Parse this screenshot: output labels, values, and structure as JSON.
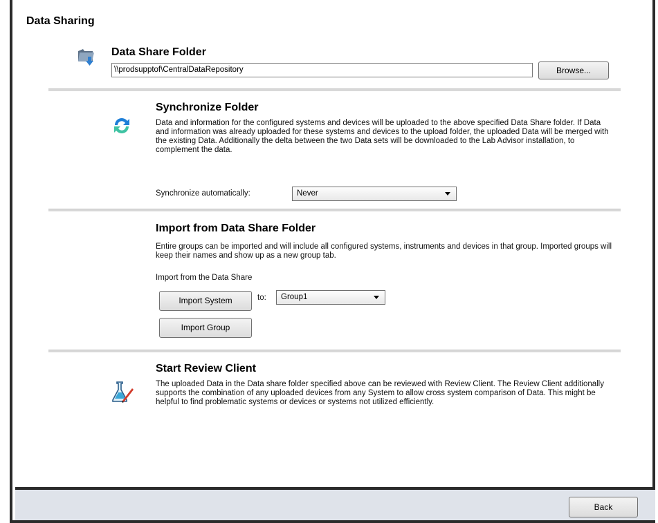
{
  "page_title": "Data Sharing",
  "data_share": {
    "heading": "Data Share Folder",
    "path_value": "\\\\prodsupptof\\CentralDataRepository",
    "browse_label": "Browse..."
  },
  "synchronize": {
    "heading": "Synchronize Folder",
    "description": "Data and information for the configured systems and devices will be uploaded to the above specified Data Share folder. If Data and information was already uploaded for these systems and devices to the upload folder, the uploaded Data will be merged with the existing Data. Additionally the delta between the two Data sets will be downloaded to the Lab Advisor installation, to complement the data.",
    "auto_label": "Synchronize automatically:",
    "auto_value": "Never"
  },
  "import": {
    "heading": "Import from Data Share Folder",
    "description": "Entire groups can be imported and will include all configured systems, instruments and devices in that group. Imported groups will keep their names and show up as a new group tab.",
    "subheading": "Import from the Data Share",
    "import_system_label": "Import System",
    "to_label": "to:",
    "group_value": "Group1",
    "import_group_label": "Import Group"
  },
  "review": {
    "heading": "Start Review Client",
    "description": "The uploaded Data in the Data share folder specified above can be reviewed with Review Client. The Review Client additionally supports the combination of any uploaded devices from any System to allow cross system comparison of Data. This might be helpful to find problematic systems or devices or systems not utilized efficiently."
  },
  "footer": {
    "back_label": "Back"
  },
  "icons": [
    "folder-download-icon",
    "sync-arrows-icon",
    "review-client-icon"
  ],
  "colors": {
    "footer_bg": "#dfe3ea",
    "frame": "#2b2b2b",
    "separator": "#d8d8d8"
  }
}
